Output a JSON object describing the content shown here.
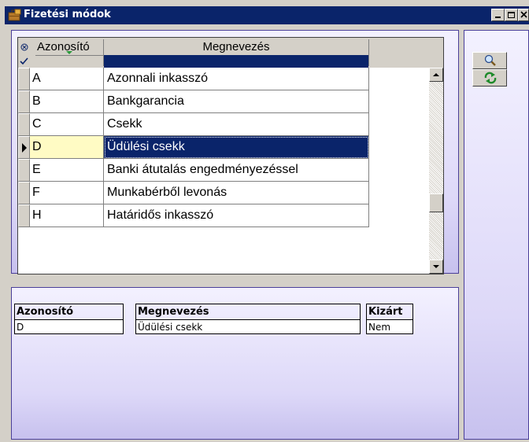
{
  "window": {
    "title": "Fizetési módok",
    "title_icon": "briefcase-icon",
    "controls": [
      "minimize-icon",
      "maximize-icon",
      "close-icon"
    ]
  },
  "grid": {
    "columns": [
      "Azonosító",
      "Megnevezés"
    ],
    "rows": [
      {
        "id": "A",
        "name": "Azonnali inkasszó"
      },
      {
        "id": "B",
        "name": "Bankgarancia"
      },
      {
        "id": "C",
        "name": "Csekk"
      },
      {
        "id": "D",
        "name": "Üdülési csekk"
      },
      {
        "id": "E",
        "name": "Banki átutalás engedményezéssel"
      },
      {
        "id": "F",
        "name": "Munkabérből levonás"
      },
      {
        "id": "H",
        "name": "Határidős inkasszó"
      }
    ],
    "selected_row": 3,
    "selection_color": "#0a246a",
    "current_cell_color": "#fffbc4"
  },
  "detail": {
    "labels": {
      "id": "Azonosító",
      "name": "Megnevezés",
      "excluded": "Kizárt"
    },
    "values": {
      "id": "D",
      "name": "Üdülési csekk",
      "excluded": "Nem"
    }
  },
  "side_buttons": [
    "search-icon",
    "refresh-icon"
  ],
  "colors": {
    "titlebar": "#0a246a",
    "panel_border": "#4a3f9a",
    "panel_gradient_end": "#c7c1ee"
  }
}
